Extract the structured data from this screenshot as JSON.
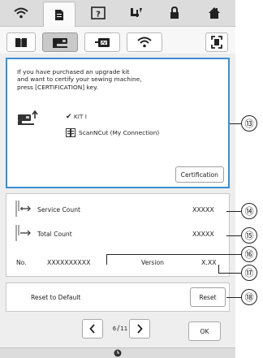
{
  "top_icons": [
    "wifi-icon",
    "document-icon",
    "help-icon",
    "needle-icon",
    "lock-icon",
    "home-icon"
  ],
  "mode_icons": [
    "book-icon",
    "machine-icon",
    "embroidery-icon",
    "wifi-icon",
    "fullscreen-icon"
  ],
  "info": {
    "text": "If you have purchased an upgrade kit\nand want to certify your sewing machine,\npress [CERTIFICATION] key.",
    "kit_label": "KIT I",
    "scan_label": "ScanNCut (My Connection)",
    "certification_label": "Certification"
  },
  "counts": {
    "service_label": "Service Count",
    "service_value": "XXXXX",
    "total_label": "Total Count",
    "total_value": "XXXXX",
    "no_label": "No.",
    "no_value": "XXXXXXXXXX",
    "version_label": "Version",
    "version_value": "X.XX"
  },
  "reset": {
    "label": "Reset to Default",
    "button_label": "Reset"
  },
  "pager": {
    "current": "6",
    "total": "11",
    "prev_icon": "chevron-left-icon",
    "next_icon": "chevron-right-icon"
  },
  "ok_label": "OK",
  "callouts": {
    "c13": "⑬",
    "c14": "⑭",
    "c15": "⑮",
    "c16": "⑯",
    "c17": "⑰",
    "c18": "⑱"
  },
  "colors": {
    "accent": "#3b8ed4",
    "panel": "#eeeeee",
    "bar": "#dcdcdc"
  }
}
